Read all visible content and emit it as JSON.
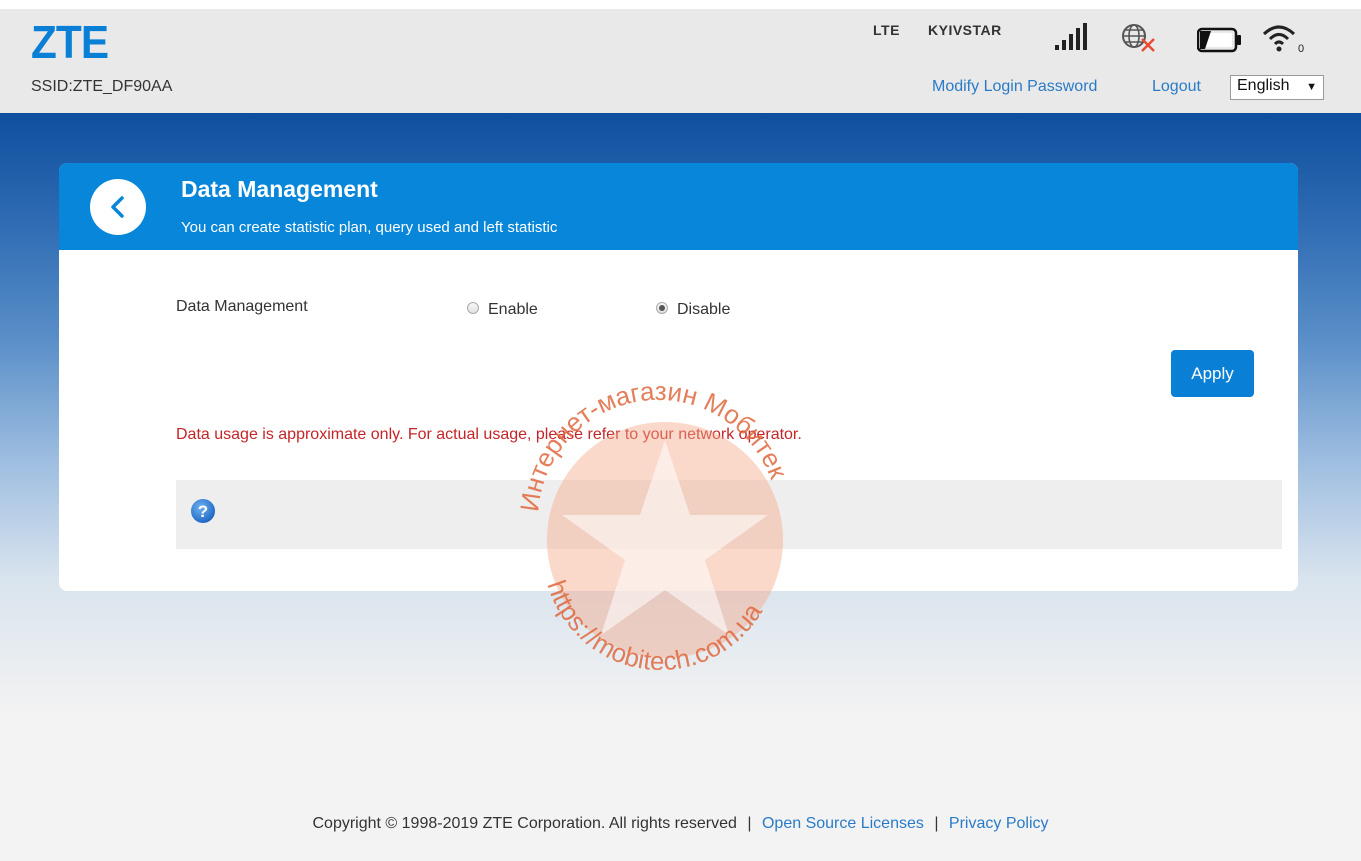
{
  "header": {
    "logo": "ZTE",
    "ssid": "SSID:ZTE_DF90AA",
    "network_type": "LTE",
    "operator": "KYIVSTAR",
    "links": {
      "modify_password": "Modify Login Password",
      "logout": "Logout"
    },
    "language": {
      "selected": "English",
      "caret": "▼"
    },
    "icons": [
      "signal-bars-icon",
      "globe-disconnected-icon",
      "battery-icon",
      "wifi-icon"
    ],
    "wifi_clients": "0"
  },
  "panel": {
    "title": "Data Management",
    "subtitle": "You can create statistic plan, query used and left statistic",
    "setting_label": "Data Management",
    "options": [
      {
        "label": "Enable",
        "checked": false
      },
      {
        "label": "Disable",
        "checked": true
      }
    ],
    "apply_label": "Apply",
    "warning": "Data usage is approximate only. For actual usage, please refer to your network operator.",
    "help_icon": "question-help-icon"
  },
  "watermark": {
    "top_text": "Интернет-магазин Мобитек",
    "bottom_text": "https://mobitech.com.ua"
  },
  "footer": {
    "copyright": "Copyright © 1998-2019 ZTE Corporation. All rights reserved",
    "separator": "|",
    "open_source": "Open Source Licenses",
    "privacy": "Privacy Policy"
  },
  "colors": {
    "brand_blue": "#0a7fd6",
    "panel_header": "#0886d9",
    "warning_red": "#c42527",
    "link_blue": "#2a7bc7"
  }
}
